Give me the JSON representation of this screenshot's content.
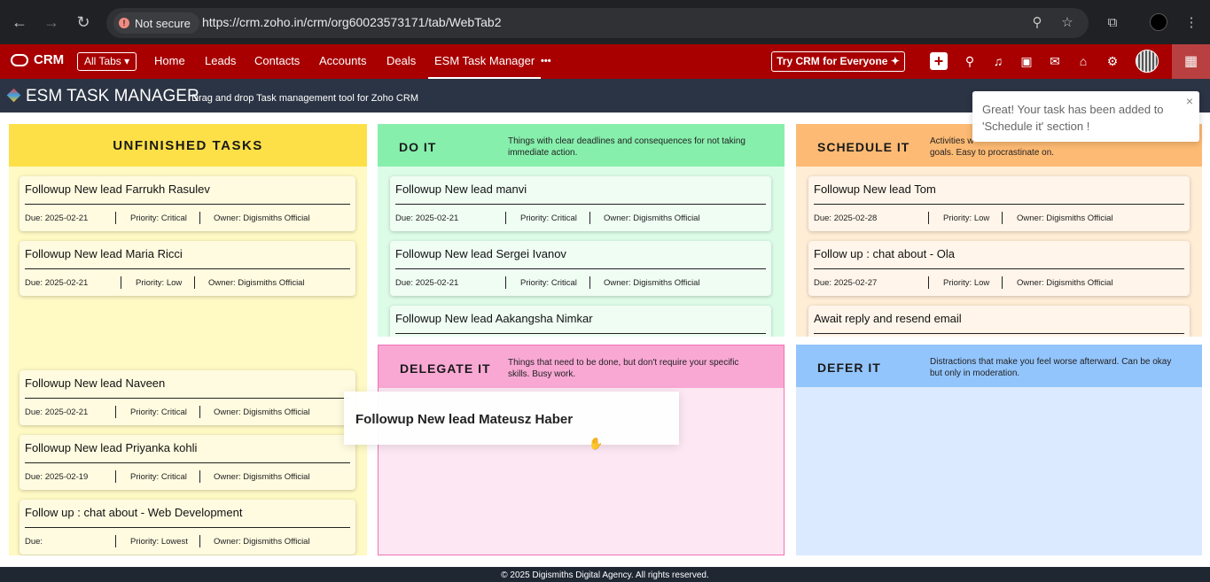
{
  "browser": {
    "security_label": "Not secure",
    "url": "https://crm.zoho.in/crm/org60023573171/tab/WebTab2"
  },
  "crm": {
    "logo": "CRM",
    "all_tabs": "All Tabs",
    "tabs": [
      "Home",
      "Leads",
      "Contacts",
      "Accounts",
      "Deals",
      "ESM Task Manager"
    ],
    "more": "•••",
    "try_button": "Try CRM for Everyone",
    "sparkle": "✦"
  },
  "app": {
    "title": "ESM TASK MANAGER",
    "subtitle": "Drag and drop Task management tool for Zoho CRM"
  },
  "columns": {
    "unfinished": {
      "title": "UNFINISHED TASKS",
      "cards": [
        {
          "title": "Followup New lead Farrukh Rasulev",
          "due": "Due: 2025-02-21",
          "priority": "Priority: Critical",
          "owner": "Owner: Digismiths Official"
        },
        {
          "title": "Followup New lead Maria Ricci",
          "due": "Due: 2025-02-21",
          "priority": "Priority: Low",
          "owner": "Owner: Digismiths Official"
        },
        {
          "title": "Followup New lead Naveen",
          "due": "Due: 2025-02-21",
          "priority": "Priority: Critical",
          "owner": "Owner: Digismiths Official"
        },
        {
          "title": "Followup New lead Priyanka kohli",
          "due": "Due: 2025-02-19",
          "priority": "Priority: Critical",
          "owner": "Owner: Digismiths Official"
        },
        {
          "title": "Follow up : chat about - Web Development",
          "due": "Due:",
          "priority": "Priority: Lowest",
          "owner": "Owner: Digismiths Official"
        }
      ]
    },
    "doit": {
      "title": "DO IT",
      "description": "Things with clear deadlines and consequences for not taking immediate action.",
      "cards": [
        {
          "title": "Followup New lead manvi",
          "due": "Due: 2025-02-21",
          "priority": "Priority: Critical",
          "owner": "Owner: Digismiths Official"
        },
        {
          "title": "Followup New lead Sergei Ivanov",
          "due": "Due: 2025-02-21",
          "priority": "Priority: Critical",
          "owner": "Owner: Digismiths Official"
        },
        {
          "title": "Followup New lead Aakangsha Nimkar"
        }
      ]
    },
    "schedule": {
      "title": "SCHEDULE IT",
      "description_start": "Activities w",
      "description_end": "goals. Easy to procrastinate on.",
      "cards": [
        {
          "title": "Followup New lead Tom",
          "due": "Due: 2025-02-28",
          "priority": "Priority: Low",
          "owner": "Owner: Digismiths Official"
        },
        {
          "title": "Follow up : chat about - Ola",
          "due": "Due: 2025-02-27",
          "priority": "Priority: Low",
          "owner": "Owner: Digismiths Official"
        },
        {
          "title": "Await reply and resend email"
        }
      ]
    },
    "delegate": {
      "title": "DELEGATE IT",
      "description": "Things that need to be done, but don't require your specific skills. Busy work."
    },
    "defer": {
      "title": "DEFER IT",
      "description": "Distractions that make you feel worse afterward. Can be okay but only in moderation."
    }
  },
  "drag": {
    "title": "Followup New lead Mateusz Haber"
  },
  "toast": {
    "message": "Great! Your task has been added to 'Schedule it' section !",
    "close": "×"
  },
  "footer": "© 2025 Digismiths Digital Agency. All rights reserved.",
  "colors": {
    "crm_red": "#a80000",
    "unfinished": "#fde047",
    "doit": "#86efac",
    "schedule": "#fdba74",
    "delegate": "#f9a8d4",
    "defer": "#93c5fd"
  }
}
